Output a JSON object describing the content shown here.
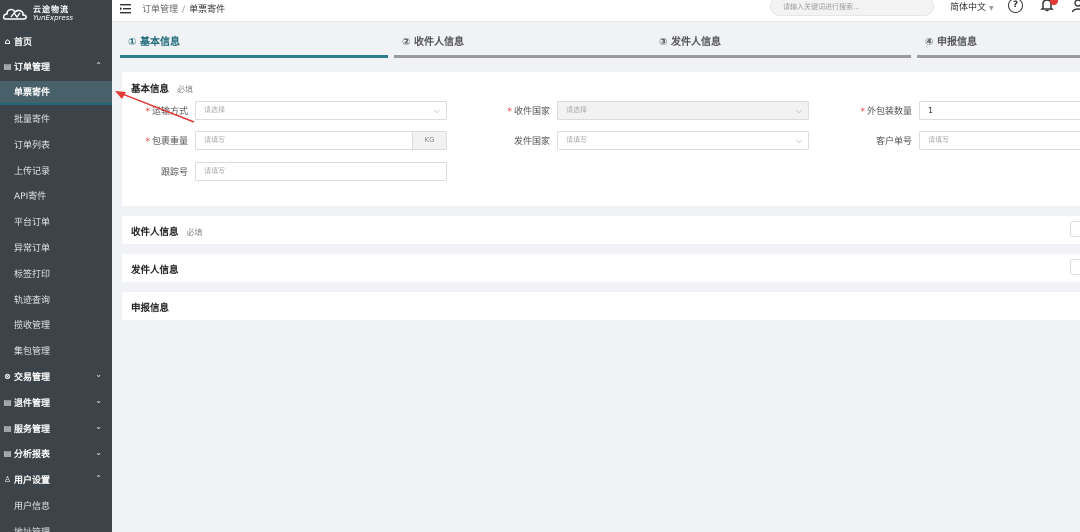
{
  "brand": {
    "name_cn": "云途物流",
    "name_en": "YunExpress"
  },
  "sidebar": {
    "items": [
      {
        "label": "首页",
        "type": "top",
        "icon": "home-icon",
        "chev": ""
      },
      {
        "label": "订单管理",
        "type": "top",
        "icon": "list-icon",
        "chev": "up"
      },
      {
        "label": "单票寄件",
        "type": "sub",
        "active": true
      },
      {
        "label": "批量寄件",
        "type": "sub"
      },
      {
        "label": "订单列表",
        "type": "sub"
      },
      {
        "label": "上传记录",
        "type": "sub"
      },
      {
        "label": "API寄件",
        "type": "sub"
      },
      {
        "label": "平台订单",
        "type": "sub"
      },
      {
        "label": "异常订单",
        "type": "sub"
      },
      {
        "label": "标签打印",
        "type": "sub"
      },
      {
        "label": "轨迹查询",
        "type": "sub"
      },
      {
        "label": "揽收管理",
        "type": "sub"
      },
      {
        "label": "集包管理",
        "type": "sub"
      },
      {
        "label": "交易管理",
        "type": "top",
        "icon": "money-icon",
        "chev": "down"
      },
      {
        "label": "退件管理",
        "type": "top",
        "icon": "list-icon",
        "chev": "down"
      },
      {
        "label": "服务管理",
        "type": "top",
        "icon": "list-icon",
        "chev": "down"
      },
      {
        "label": "分析报表",
        "type": "top",
        "icon": "list-icon",
        "chev": "down"
      },
      {
        "label": "用户设置",
        "type": "top",
        "icon": "user-icon",
        "chev": "up"
      },
      {
        "label": "用户信息",
        "type": "sub"
      },
      {
        "label": "地址管理",
        "type": "sub"
      }
    ]
  },
  "header": {
    "breadcrumb": [
      "订单管理",
      "单票寄件"
    ],
    "breadcrumb_sep": "/",
    "search_placeholder": "请输入关键词进行搜索...",
    "language": "简体中文",
    "help": "?"
  },
  "steps": [
    {
      "label": "① 基本信息",
      "active": true
    },
    {
      "label": "② 收件人信息",
      "active": false
    },
    {
      "label": "③ 发件人信息",
      "active": false
    },
    {
      "label": "④ 申报信息",
      "active": false
    }
  ],
  "basic": {
    "title": "基本信息",
    "hint": "必填",
    "transport_label": "运输方式",
    "transport_placeholder": "请选择",
    "dest_country_label": "收件国家",
    "dest_country_placeholder": "请选择",
    "outer_pkg_label": "外包装数量",
    "outer_pkg_value": "1",
    "weight_label": "包裹重量",
    "weight_placeholder": "请填写",
    "weight_unit": "KG",
    "origin_country_label": "发件国家",
    "origin_country_placeholder": "请填写",
    "customer_no_label": "客户单号",
    "customer_no_placeholder": "请填写",
    "tracking_label": "跟踪号",
    "tracking_placeholder": "请填写",
    "required_mark": "*"
  },
  "recipient": {
    "title": "收件人信息",
    "hint": "必填"
  },
  "sender": {
    "title": "发件人信息"
  },
  "declaration": {
    "title": "申报信息"
  },
  "colors": {
    "sidebar_bg": "#3c4449",
    "accent": "#2d7d8c",
    "arrow": "#e53935"
  }
}
